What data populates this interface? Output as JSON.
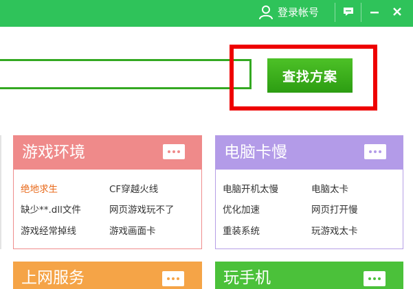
{
  "titlebar": {
    "login_label": "登录帐号"
  },
  "search": {
    "placeholder": "",
    "button_label": "查找方案"
  },
  "cards": [
    {
      "title": "游戏环境",
      "links": [
        "绝地求生",
        "CF穿越火线",
        "缺少**.dll文件",
        "网页游戏玩不了",
        "游戏经常掉线",
        "游戏画面卡"
      ],
      "highlighted": "绝地求生"
    },
    {
      "title": "电脑卡慢",
      "links": [
        "电脑开机太慢",
        "电脑太卡",
        "优化加速",
        "网页打开慢",
        "重装系统",
        "玩游戏太卡"
      ]
    },
    {
      "title": "上网服务"
    },
    {
      "title": "玩手机"
    }
  ],
  "colors": {
    "titlebar": "#2fc35a",
    "search_border": "#33a821",
    "find_button": "#3fb11e",
    "highlight_box": "#ee0000",
    "card_game": "#ef8a8a",
    "card_pc": "#b39be8",
    "card_net": "#f5a447",
    "card_phone": "#4bc13a",
    "hot_link": "#e8691a"
  },
  "icons": [
    "user-icon",
    "message-icon",
    "minimize-icon",
    "close-icon",
    "more-dots-icon"
  ]
}
